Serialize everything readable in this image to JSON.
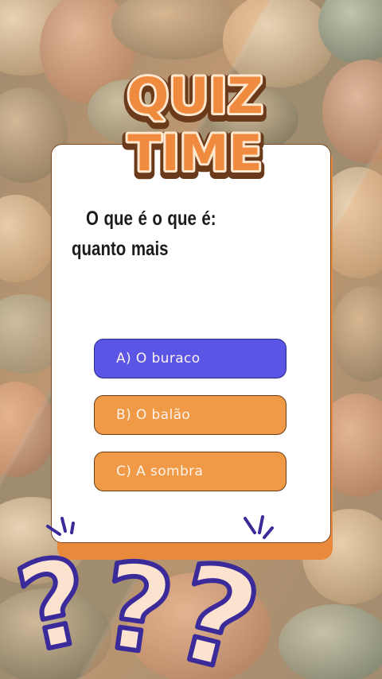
{
  "title": {
    "line1": "QUIZ",
    "line2": "TIME"
  },
  "question": "O que é o que é: quanto mais",
  "answers": [
    {
      "label": "A) O buraco"
    },
    {
      "label": "B) O balão"
    },
    {
      "label": "C) A sombra"
    }
  ],
  "colors": {
    "title_fill": "#f08a3e",
    "title_outline": "#6b3a1a",
    "title_highlight": "#fde7cf",
    "answer_selected": "#5b55e6",
    "answer_default": "#f09a47",
    "card_shadow": "#e9893c",
    "qmark_fill": "#fbe3cf",
    "qmark_stroke": "#3b2a9a"
  },
  "icons": [
    "question-mark-icon",
    "sparkle-icon"
  ]
}
